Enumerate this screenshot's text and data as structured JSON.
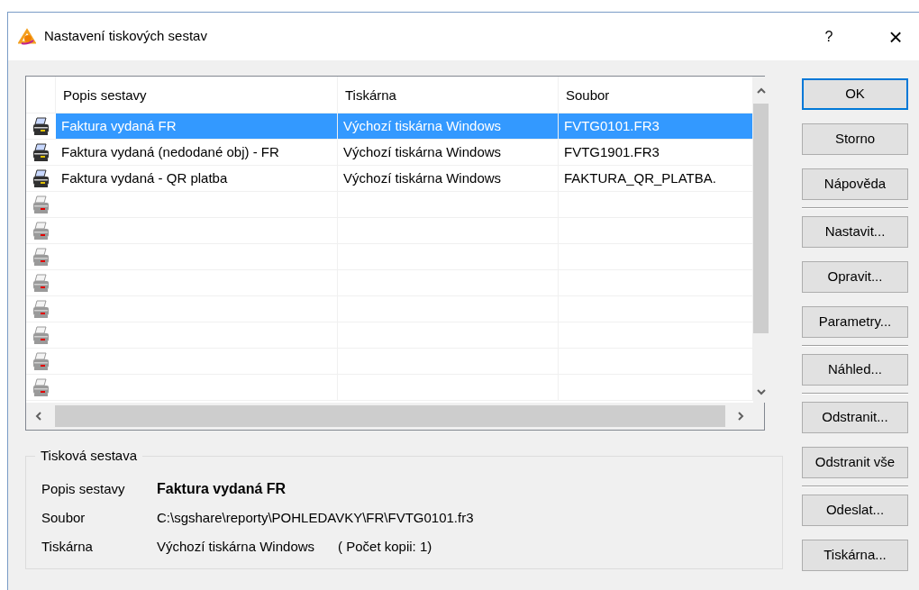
{
  "window": {
    "title": "Nastavení tiskových sestav",
    "help": "?",
    "close": "×"
  },
  "table": {
    "columns": [
      "Popis sestavy",
      "Tiskárna",
      "Soubor"
    ],
    "rows": [
      {
        "kind": "report",
        "selected": true,
        "cells": [
          "Faktura vydaná FR",
          "Výchozí tiskárna Windows",
          "FVTG0101.FR3"
        ]
      },
      {
        "kind": "report",
        "selected": false,
        "cells": [
          "Faktura vydaná (nedodané obj) - FR",
          "Výchozí tiskárna Windows",
          "FVTG1901.FR3"
        ]
      },
      {
        "kind": "report",
        "selected": false,
        "cells": [
          "Faktura vydaná - QR platba",
          "Výchozí tiskárna Windows",
          "FAKTURA_QR_PLATBA."
        ]
      },
      {
        "kind": "empty",
        "selected": false
      },
      {
        "kind": "empty",
        "selected": false
      },
      {
        "kind": "empty",
        "selected": false
      },
      {
        "kind": "empty",
        "selected": false
      },
      {
        "kind": "empty",
        "selected": false
      },
      {
        "kind": "empty",
        "selected": false
      },
      {
        "kind": "empty",
        "selected": false
      },
      {
        "kind": "empty",
        "selected": false
      }
    ]
  },
  "buttons": [
    {
      "kind": "button",
      "label": "OK",
      "default": true
    },
    {
      "kind": "button",
      "label": "Storno",
      "default": false
    },
    {
      "kind": "button",
      "label": "Nápověda",
      "default": false
    },
    {
      "kind": "separator"
    },
    {
      "kind": "button",
      "label": "Nastavit...",
      "default": false
    },
    {
      "kind": "button",
      "label": "Opravit...",
      "default": false
    },
    {
      "kind": "button",
      "label": "Parametry...",
      "default": false
    },
    {
      "kind": "separator"
    },
    {
      "kind": "button",
      "label": "Náhled...",
      "default": false
    },
    {
      "kind": "separator"
    },
    {
      "kind": "button",
      "label": "Odstranit...",
      "default": false
    },
    {
      "kind": "button",
      "label": "Odstranit vše",
      "default": false
    },
    {
      "kind": "separator"
    },
    {
      "kind": "button",
      "label": "Odeslat...",
      "default": false
    },
    {
      "kind": "button",
      "label": "Tiskárna...",
      "default": false
    }
  ],
  "details": {
    "title": "Tisková sestava",
    "fields": [
      {
        "label": "Popis sestavy",
        "value": "Faktura vydaná FR",
        "bold": true
      },
      {
        "label": "Soubor",
        "value": "C:\\sgshare\\reporty\\POHLEDAVKY\\FR\\FVTG0101.fr3",
        "bold": false
      },
      {
        "label": "Tiskárna",
        "value": "Výchozí tiskárna Windows",
        "bold": false,
        "note": "( Počet kopii: 1)"
      }
    ]
  }
}
